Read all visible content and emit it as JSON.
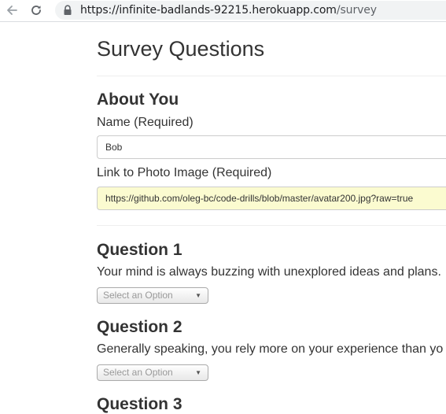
{
  "browser": {
    "url_domain": "https://infinite-badlands-92215.herokuapp.com",
    "url_path": "/survey"
  },
  "page": {
    "title": "Survey Questions"
  },
  "about": {
    "heading": "About You",
    "name_label": "Name (Required)",
    "name_value": "Bob",
    "photo_label": "Link to Photo Image (Required)",
    "photo_value": "https://github.com/oleg-bc/code-drills/blob/master/avatar200.jpg?raw=true"
  },
  "questions": [
    {
      "heading": "Question 1",
      "text": "Your mind is always buzzing with unexplored ideas and plans.",
      "select_value": "Select an Option"
    },
    {
      "heading": "Question 2",
      "text": "Generally speaking, you rely more on your experience than yo",
      "select_value": "Select an Option"
    },
    {
      "heading": "Question 3"
    }
  ],
  "colors": {
    "filled_input_bg": "#fbfbd0",
    "text": "#333333"
  }
}
